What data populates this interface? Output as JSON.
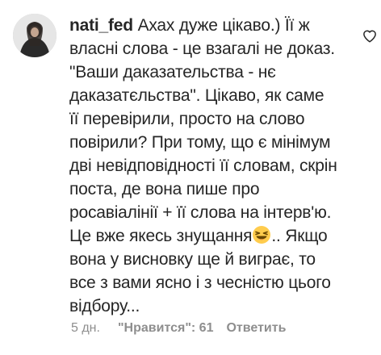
{
  "comment": {
    "username": "nati_fed",
    "lines": [
      "Ахах дуже цікаво.) Її ж",
      "власні слова - це взагалі не доказ.",
      "\"Ваши даказательства - нє",
      "даказатєльства\". Цікаво, як саме",
      "її перевірили, просто на слово",
      "повірили? При тому, що є мінімум",
      "дві невідповідності її словам, скрін",
      "поста, де вона пише про",
      "росавіалінії + її слова на інтерв'ю.",
      "Це вже якесь знущання",
      ".. Якщо",
      "вона у висновку ще й виграє, то",
      "все з вами ясно і з чесністю цього",
      "відбору..."
    ],
    "emoji": "laughing-face-emoji",
    "time": "5 дн.",
    "likes_label": "\"Нравится\": 61",
    "reply_label": "Ответить"
  },
  "icons": {
    "like": "heart-outline-icon",
    "avatar": "user-avatar"
  },
  "colors": {
    "text": "#262626",
    "meta": "#8e8e8e",
    "emoji_face": "#FFCC4D"
  }
}
